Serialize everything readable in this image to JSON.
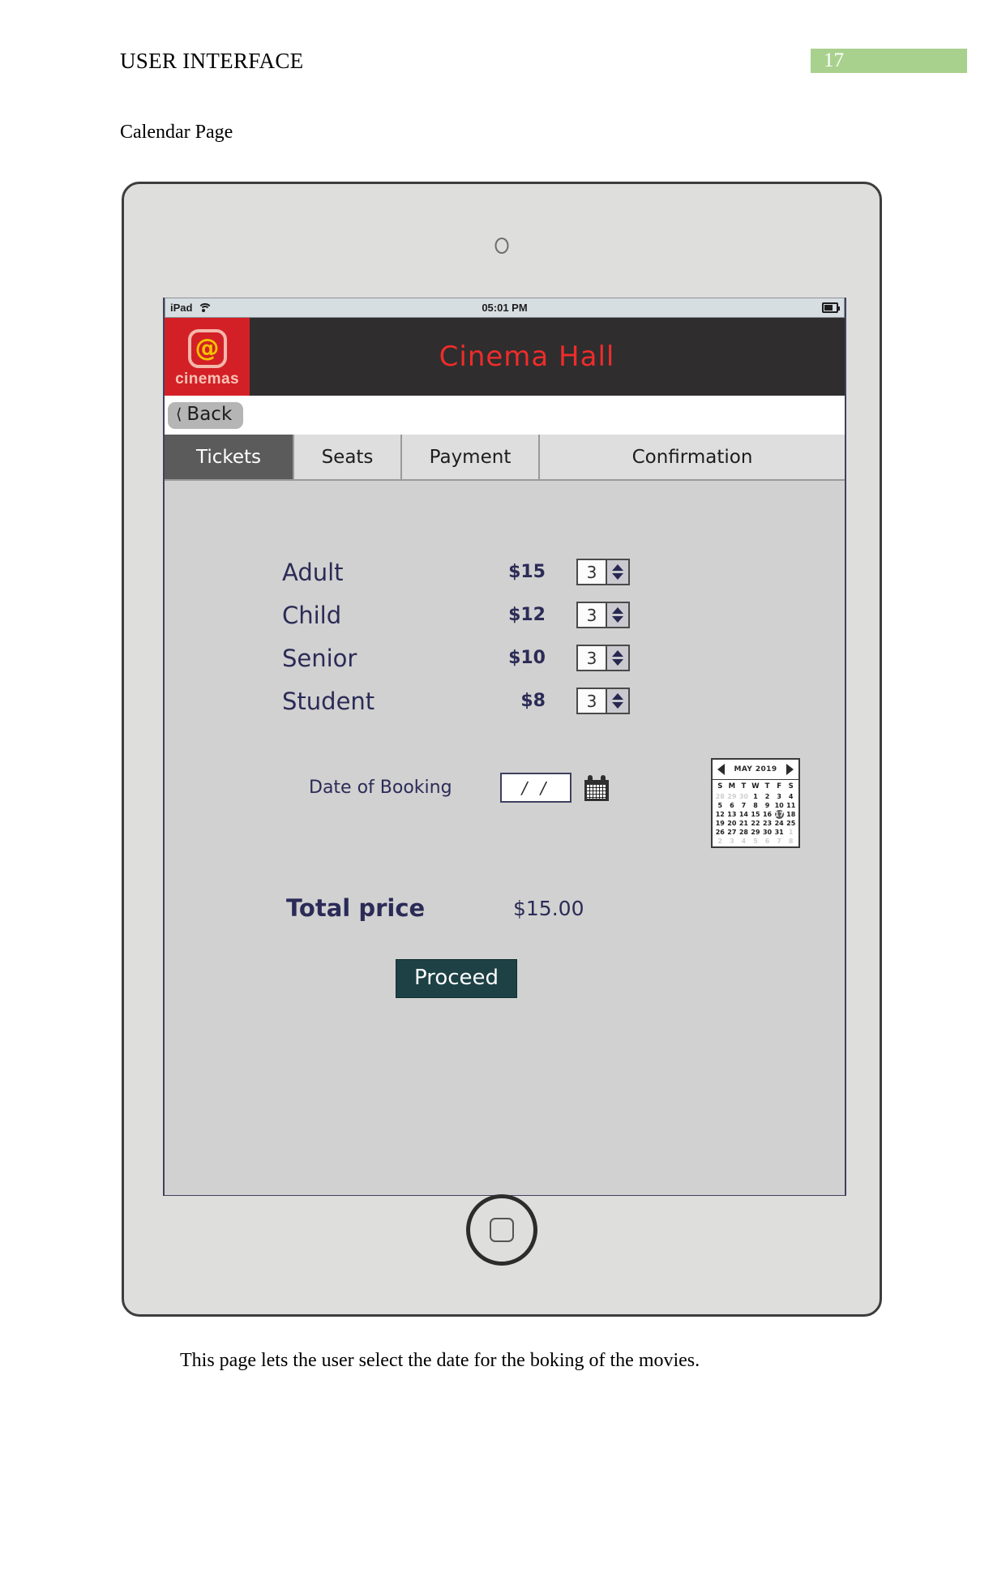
{
  "document": {
    "title": "USER INTERFACE",
    "page_number": "17",
    "subtitle": "Calendar Page",
    "caption": "This page lets the user select the date for the boking of the movies.",
    "badge_color": "#a9d18e"
  },
  "device": {
    "status_bar": {
      "carrier": "iPad",
      "wifi_icon": "wifi-icon",
      "time": "05:01 PM",
      "battery_icon": "battery-icon"
    }
  },
  "app": {
    "logo": {
      "mark": "@",
      "text": "cinemas",
      "background": "#d32027",
      "mark_color": "#f5c400"
    },
    "title": "Cinema Hall",
    "title_color": "#ef2c2c",
    "header_background": "#2f2d2d",
    "back_button": {
      "label": "Back",
      "chevron_icon": "chevron-left-icon"
    },
    "tabs": [
      {
        "label": "Tickets",
        "active": true
      },
      {
        "label": "Seats",
        "active": false
      },
      {
        "label": "Payment",
        "active": false
      },
      {
        "label": "Confirmation",
        "active": false
      }
    ]
  },
  "tickets": {
    "rows": [
      {
        "name": "Adult",
        "price": "$15",
        "quantity": "3"
      },
      {
        "name": "Child",
        "price": "$12",
        "quantity": "3"
      },
      {
        "name": "Senior",
        "price": "$10",
        "quantity": "3"
      },
      {
        "name": "Student",
        "price": "$8",
        "quantity": "3"
      }
    ]
  },
  "booking": {
    "date_label": "Date of Booking",
    "date_value": "/  /",
    "date_placeholder": "/  /",
    "calendar_icon": "calendar-icon"
  },
  "calendar": {
    "month_label": "MAY 2019",
    "prev_icon": "arrow-left-icon",
    "next_icon": "arrow-right-icon",
    "day_headers": [
      "S",
      "M",
      "T",
      "W",
      "T",
      "F",
      "S"
    ],
    "weeks": [
      [
        {
          "d": "28",
          "muted": true
        },
        {
          "d": "29",
          "muted": true
        },
        {
          "d": "30",
          "muted": true
        },
        {
          "d": "1"
        },
        {
          "d": "2"
        },
        {
          "d": "3"
        },
        {
          "d": "4"
        }
      ],
      [
        {
          "d": "5"
        },
        {
          "d": "6"
        },
        {
          "d": "7"
        },
        {
          "d": "8"
        },
        {
          "d": "9"
        },
        {
          "d": "10"
        },
        {
          "d": "11"
        }
      ],
      [
        {
          "d": "12"
        },
        {
          "d": "13"
        },
        {
          "d": "14"
        },
        {
          "d": "15"
        },
        {
          "d": "16"
        },
        {
          "d": "17",
          "selected": true
        },
        {
          "d": "18"
        }
      ],
      [
        {
          "d": "19"
        },
        {
          "d": "20"
        },
        {
          "d": "21"
        },
        {
          "d": "22"
        },
        {
          "d": "23"
        },
        {
          "d": "24"
        },
        {
          "d": "25"
        }
      ],
      [
        {
          "d": "26"
        },
        {
          "d": "27"
        },
        {
          "d": "28"
        },
        {
          "d": "29"
        },
        {
          "d": "30"
        },
        {
          "d": "31"
        },
        {
          "d": "1",
          "muted": true
        }
      ],
      [
        {
          "d": "2",
          "muted": true
        },
        {
          "d": "3",
          "muted": true
        },
        {
          "d": "4",
          "muted": true
        },
        {
          "d": "5",
          "muted": true
        },
        {
          "d": "6",
          "muted": true
        },
        {
          "d": "7",
          "muted": true
        },
        {
          "d": "8",
          "muted": true
        }
      ]
    ],
    "selected_day": "17"
  },
  "total": {
    "label": "Total price",
    "value": "$15.00"
  },
  "actions": {
    "proceed_label": "Proceed",
    "proceed_color": "#1d4145"
  }
}
